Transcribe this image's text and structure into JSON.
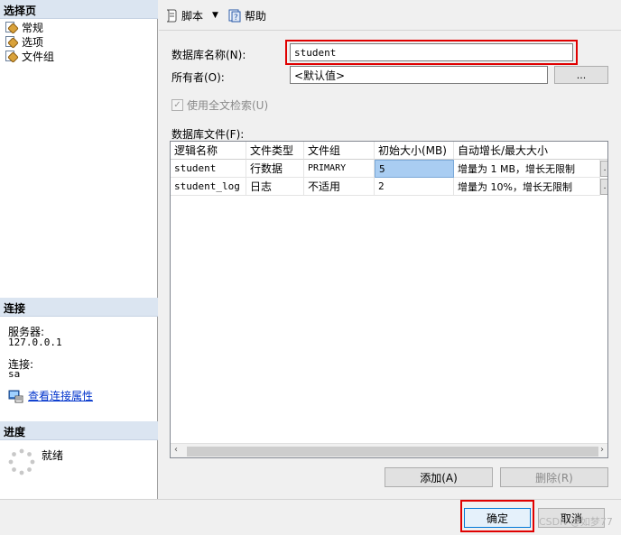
{
  "left": {
    "select_page_header": "选择页",
    "pages": [
      "常规",
      "选项",
      "文件组"
    ],
    "connection_header": "连接",
    "server_label": "服务器:",
    "server_value": "127.0.0.1",
    "connection_label": "连接:",
    "connection_value": "sa",
    "view_props_link": "查看连接属性",
    "progress_header": "进度",
    "progress_status": "就绪"
  },
  "toolbar": {
    "script_label": "脚本",
    "help_label": "帮助"
  },
  "form": {
    "db_name_label": "数据库名称(N):",
    "db_name_value": "student",
    "owner_label": "所有者(O):",
    "owner_value": "<默认值>",
    "owner_browse": "...",
    "fulltext_label": "使用全文检索(U)",
    "files_label": "数据库文件(F):"
  },
  "grid": {
    "columns": [
      "逻辑名称",
      "文件类型",
      "文件组",
      "初始大小(MB)",
      "自动增长/最大大小"
    ],
    "rows": [
      [
        "student",
        "行数据",
        "PRIMARY",
        "5",
        "增量为 1 MB，增长无限制"
      ],
      [
        "student_log",
        "日志",
        "不适用",
        "2",
        "增量为 10%，增长无限制"
      ]
    ]
  },
  "buttons": {
    "add": "添加(A)",
    "remove": "删除(R)",
    "ok": "确定",
    "cancel": "取消"
  },
  "watermark": "CSDN @如梦77"
}
